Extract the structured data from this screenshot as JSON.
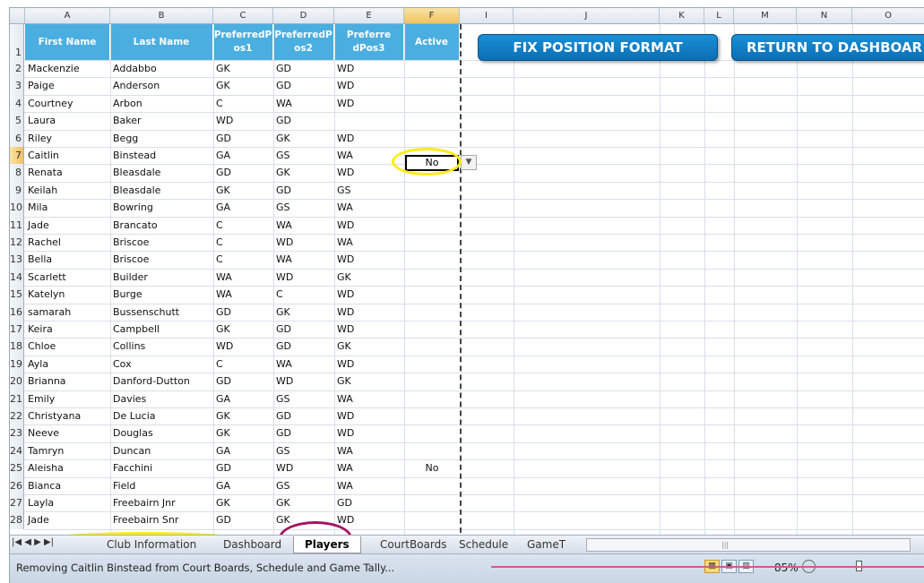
{
  "columns": [
    "A",
    "B",
    "C",
    "D",
    "E",
    "F",
    "I",
    "J",
    "K",
    "L",
    "M",
    "N",
    "O"
  ],
  "selected_column": "F",
  "selected_row": "7",
  "headers": {
    "first_name": "First Name",
    "last_name": "Last Name",
    "pos1": "PreferredP\nos1",
    "pos2": "PreferredP\nos2",
    "pos3": "Preferre\ndPos3",
    "active": "Active"
  },
  "buttons": {
    "fix_position_format": "FIX POSITION FORMAT",
    "return_to_dashboard": "RETURN TO DASHBOAR"
  },
  "rows": [
    {
      "num": "1"
    },
    {
      "num": "2",
      "first": "Mackenzie",
      "last": "Addabbo",
      "p1": "GK",
      "p2": "GD",
      "p3": "WD",
      "active": ""
    },
    {
      "num": "3",
      "first": "Paige",
      "last": "Anderson",
      "p1": "GK",
      "p2": "GD",
      "p3": "WD",
      "active": ""
    },
    {
      "num": "4",
      "first": "Courtney",
      "last": "Arbon",
      "p1": "C",
      "p2": "WA",
      "p3": "WD",
      "active": ""
    },
    {
      "num": "5",
      "first": "Laura",
      "last": "Baker",
      "p1": "WD",
      "p2": "GD",
      "p3": "",
      "active": ""
    },
    {
      "num": "6",
      "first": "Riley",
      "last": "Begg",
      "p1": "GD",
      "p2": "GK",
      "p3": "WD",
      "active": ""
    },
    {
      "num": "7",
      "first": "Caitlin",
      "last": "Binstead",
      "p1": "GA",
      "p2": "GS",
      "p3": "WA",
      "active": "No"
    },
    {
      "num": "8",
      "first": "Renata",
      "last": "Bleasdale",
      "p1": "GD",
      "p2": "GK",
      "p3": "WD",
      "active": ""
    },
    {
      "num": "9",
      "first": "Keilah",
      "last": "Bleasdale",
      "p1": "GK",
      "p2": "GD",
      "p3": "GS",
      "active": ""
    },
    {
      "num": "10",
      "first": "Mila",
      "last": "Bowring",
      "p1": "GA",
      "p2": "GS",
      "p3": "WA",
      "active": ""
    },
    {
      "num": "11",
      "first": "Jade",
      "last": "Brancato",
      "p1": "C",
      "p2": "WA",
      "p3": "WD",
      "active": ""
    },
    {
      "num": "12",
      "first": "Rachel",
      "last": "Briscoe",
      "p1": "C",
      "p2": "WD",
      "p3": "WA",
      "active": ""
    },
    {
      "num": "13",
      "first": "Bella",
      "last": "Briscoe",
      "p1": "C",
      "p2": "WA",
      "p3": "WD",
      "active": ""
    },
    {
      "num": "14",
      "first": "Scarlett",
      "last": "Builder",
      "p1": "WA",
      "p2": "WD",
      "p3": "GK",
      "active": ""
    },
    {
      "num": "15",
      "first": "Katelyn",
      "last": "Burge",
      "p1": "WA",
      "p2": "C",
      "p3": "WD",
      "active": ""
    },
    {
      "num": "16",
      "first": "samarah",
      "last": "Bussenschutt",
      "p1": "GD",
      "p2": "GK",
      "p3": "WD",
      "active": ""
    },
    {
      "num": "17",
      "first": "Keira",
      "last": "Campbell",
      "p1": "GK",
      "p2": "GD",
      "p3": "WD",
      "active": ""
    },
    {
      "num": "18",
      "first": "Chloe",
      "last": "Collins",
      "p1": "WD",
      "p2": "GD",
      "p3": "GK",
      "active": ""
    },
    {
      "num": "19",
      "first": "Ayla",
      "last": "Cox",
      "p1": "C",
      "p2": "WA",
      "p3": "WD",
      "active": ""
    },
    {
      "num": "20",
      "first": "Brianna",
      "last": "Danford-Dutton",
      "p1": "GD",
      "p2": "WD",
      "p3": "GK",
      "active": ""
    },
    {
      "num": "21",
      "first": "Emily",
      "last": "Davies",
      "p1": "GA",
      "p2": "GS",
      "p3": "WA",
      "active": ""
    },
    {
      "num": "22",
      "first": "Christyana",
      "last": "De Lucia",
      "p1": "GK",
      "p2": "GD",
      "p3": "WD",
      "active": ""
    },
    {
      "num": "23",
      "first": "Neeve",
      "last": "Douglas",
      "p1": "GK",
      "p2": "GD",
      "p3": "WD",
      "active": ""
    },
    {
      "num": "24",
      "first": "Tamryn",
      "last": "Duncan",
      "p1": "GA",
      "p2": "GS",
      "p3": "WA",
      "active": ""
    },
    {
      "num": "25",
      "first": "Aleisha",
      "last": "Facchini",
      "p1": "GD",
      "p2": "WD",
      "p3": "WA",
      "active": "No"
    },
    {
      "num": "26",
      "first": "Bianca",
      "last": "Field",
      "p1": "GA",
      "p2": "GS",
      "p3": "WA",
      "active": ""
    },
    {
      "num": "27",
      "first": "Layla",
      "last": "Freebairn Jnr",
      "p1": "GK",
      "p2": "GK",
      "p3": "GD",
      "active": ""
    },
    {
      "num": "28",
      "first": "Jade",
      "last": "Freebairn Snr",
      "p1": "GD",
      "p2": "GK",
      "p3": "WD",
      "active": ""
    }
  ],
  "sheet_tabs": [
    "Club Information",
    "Dashboard",
    "Players",
    "CourtBoards",
    "Schedule",
    "GameT"
  ],
  "active_tab": "Players",
  "status_message": "Removing Caitlin Binstead from Court Boards, Schedule and Game Tally...",
  "zoom": "85%",
  "colors": {
    "header_blue": "#4aaee0",
    "button_blue": "#0a6fb5",
    "highlight_yellow": "#ffeb19",
    "highlight_purple": "#a4135f"
  }
}
